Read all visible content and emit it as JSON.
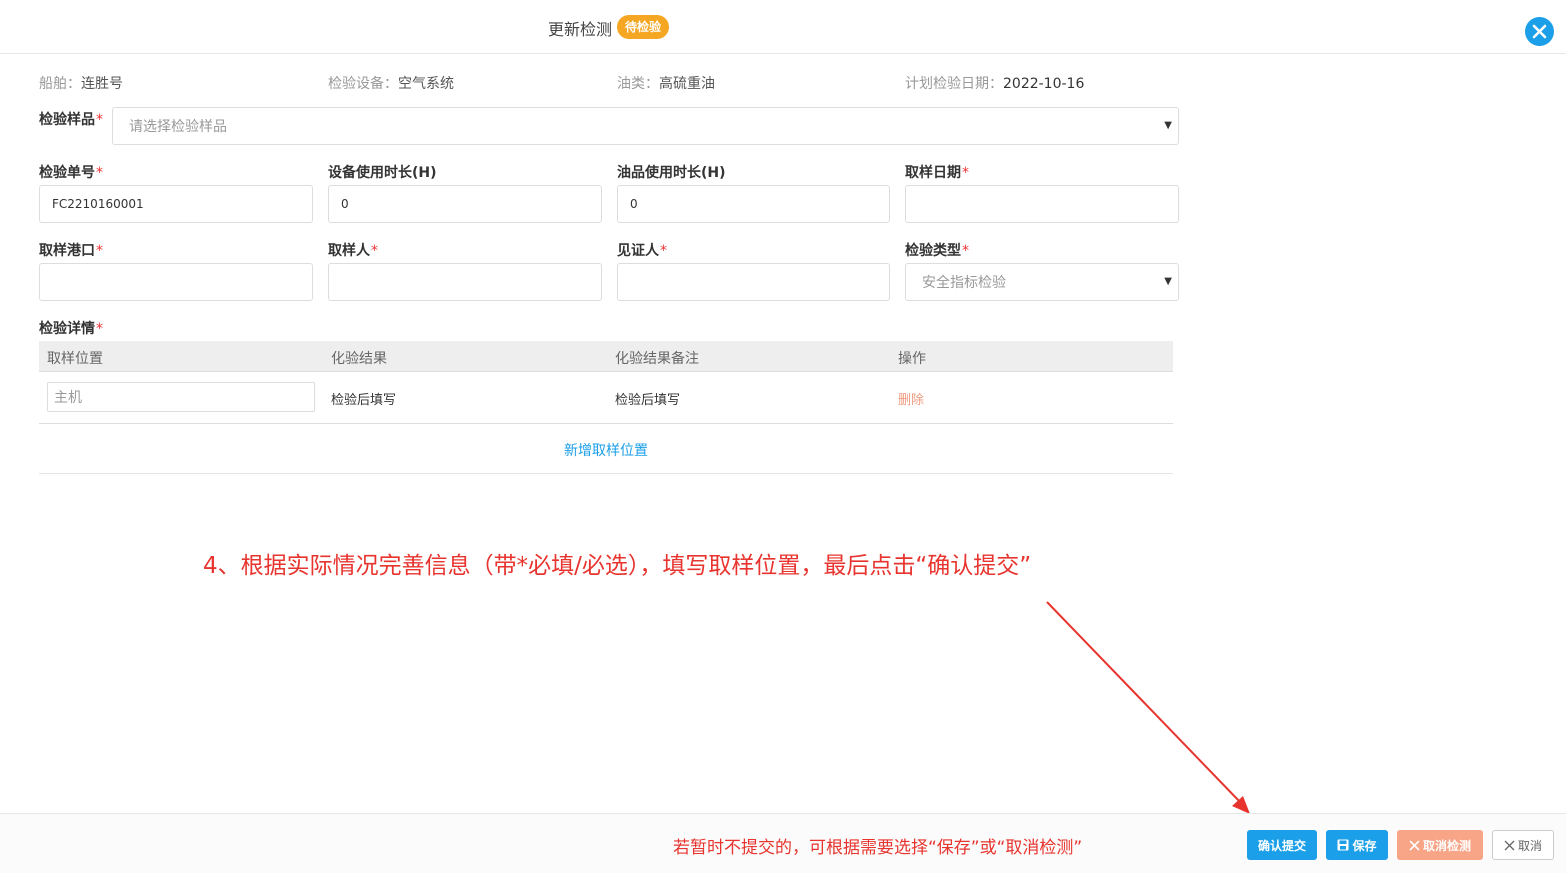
{
  "header": {
    "title": "更新检测",
    "status_badge": "待检验"
  },
  "info": {
    "ship_label": "船舶：",
    "ship_value": "连胜号",
    "device_label": "检验设备：",
    "device_value": "空气系统",
    "oil_label": "油类：",
    "oil_value": "高硫重油",
    "date_label": "计划检验日期：",
    "date_value": "2022-10-16"
  },
  "form": {
    "sample": {
      "label": "检验样品",
      "placeholder": "请选择检验样品"
    },
    "order_no": {
      "label": "检验单号",
      "value": "FC2210160001"
    },
    "device_hours": {
      "label": "设备使用时长(H)",
      "value": "0"
    },
    "oil_hours": {
      "label": "油品使用时长(H)",
      "value": "0"
    },
    "sample_date": {
      "label": "取样日期",
      "value": ""
    },
    "sample_port": {
      "label": "取样港口",
      "value": ""
    },
    "sampler": {
      "label": "取样人",
      "value": ""
    },
    "witness": {
      "label": "见证人",
      "value": ""
    },
    "check_type": {
      "label": "检验类型",
      "value": "安全指标检验"
    },
    "required_mark": "*"
  },
  "details": {
    "label": "检验详情",
    "columns": [
      "取样位置",
      "化验结果",
      "化验结果备注",
      "操作"
    ],
    "rows": [
      {
        "location": "主机",
        "result": "检验后填写",
        "remark": "检验后填写",
        "action": "删除"
      }
    ],
    "add_label": "新增取样位置"
  },
  "annotation": "4、根据实际情况完善信息（带*必填/必选），填写取样位置，最后点击“确认提交”",
  "footer": {
    "hint": "若暂时不提交的，可根据需要选择“保存”或“取消检测”",
    "submit_label": "确认提交",
    "save_label": "保存",
    "cancel_check_label": "取消检测",
    "cancel_label": "取消"
  },
  "colors": {
    "primary": "#1a9fe8",
    "badge": "#f5a623",
    "danger_soft": "#f7a487",
    "annotation": "#e8342e"
  }
}
